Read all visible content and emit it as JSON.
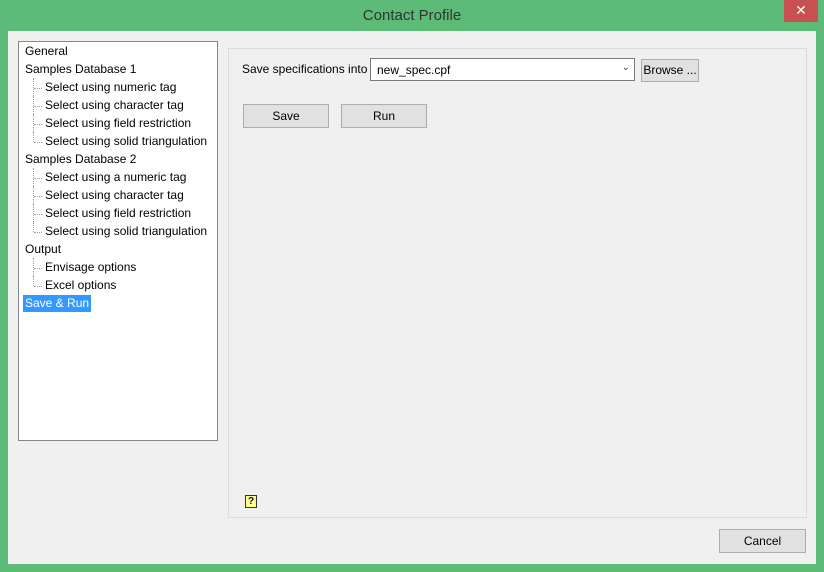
{
  "window": {
    "title": "Contact Profile",
    "close_label": "✕"
  },
  "tree": {
    "items": [
      {
        "label": "General",
        "level": 0
      },
      {
        "label": "Samples Database 1",
        "level": 0
      },
      {
        "label": "Select using numeric tag",
        "level": 1
      },
      {
        "label": "Select using character tag",
        "level": 1
      },
      {
        "label": "Select using field restriction",
        "level": 1
      },
      {
        "label": "Select using solid triangulation",
        "level": 1
      },
      {
        "label": "Samples Database 2",
        "level": 0
      },
      {
        "label": "Select using a numeric tag",
        "level": 1
      },
      {
        "label": "Select using character tag",
        "level": 1
      },
      {
        "label": "Select using field restriction",
        "level": 1
      },
      {
        "label": "Select using solid triangulation",
        "level": 1
      },
      {
        "label": "Output",
        "level": 0
      },
      {
        "label": "Envisage options",
        "level": 1
      },
      {
        "label": "Excel options",
        "level": 1
      },
      {
        "label": "Save & Run",
        "level": 0,
        "selected": true
      }
    ]
  },
  "form": {
    "save_label": "Save specifications into",
    "file_value": "new_spec.cpf",
    "browse_label": "Browse ...",
    "save_button": "Save",
    "run_button": "Run",
    "help_icon": "?"
  },
  "footer": {
    "cancel_label": "Cancel"
  }
}
